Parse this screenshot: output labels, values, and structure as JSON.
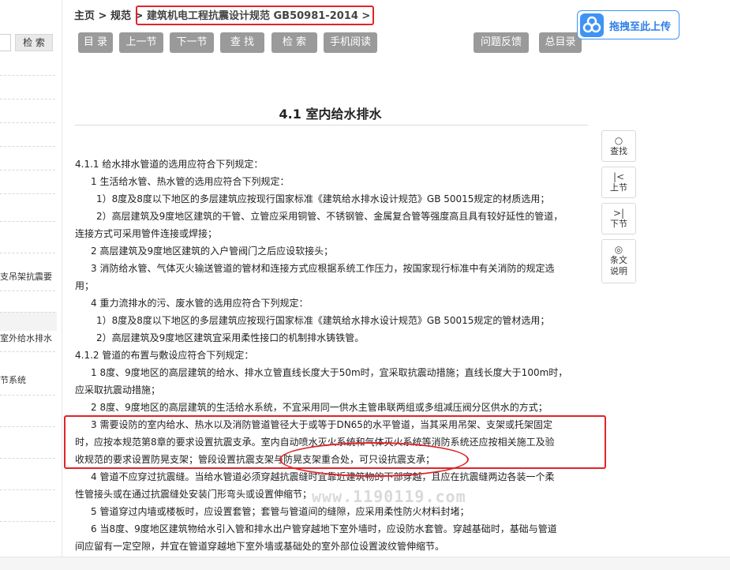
{
  "breadcrumb": {
    "home": "主页",
    "sep1": ">",
    "category": "规范",
    "sep2": ">",
    "current": "建筑机电工程抗震设计规范 GB50981-2014 >"
  },
  "toolbar": {
    "toc": "目 录",
    "prev": "上一节",
    "next": "下一节",
    "find": "查 找",
    "search": "检 索",
    "mobile": "手机阅读",
    "feedback": "问题反馈",
    "index": "总目录"
  },
  "sidebar": {
    "search_button": "检 索",
    "items": [
      "支吊架抗震要",
      "室外给水排水",
      "节系统"
    ]
  },
  "title": "4.1 室内给水排水",
  "paragraphs": [
    "4.1.1 给水排水管道的选用应符合下列规定：",
    "1 生活给水管、热水管的选用应符合下列规定：",
    "1）8度及8度以下地区的多层建筑应按现行国家标准《建筑给水排水设计规范》GB 50015规定的材质选用；",
    "2）高层建筑及9度地区建筑的干管、立管应采用铜管、不锈钢管、金属复合管等强度高且具有较好延性的管道，",
    "连接方式可采用管件连接或焊接；",
    "2 高层建筑及9度地区建筑的入户管阀门之后应设软接头；",
    "3 消防给水管、气体灭火输送管道的管材和连接方式应根据系统工作压力，按国家现行标准中有关消防的规定选",
    "用；",
    "4 重力流排水的污、废水管的选用应符合下列规定：",
    "1）8度及8度以下地区的多层建筑应按现行国家标准《建筑给水排水设计规范》GB 50015规定的管材选用；",
    "2）高层建筑及9度地区建筑宜采用柔性接口的机制排水铸铁管。",
    "4.1.2 管道的布置与敷设应符合下列规定：",
    "1 8度、9度地区的高层建筑的给水、排水立管直线长度大于50m时，宜采取抗震动措施；直线长度大于100m时，",
    "应采取抗震动措施；",
    "2 8度、9度地区的高层建筑的生活给水系统，不宜采用同一供水主管串联两组或多组减压阀分区供水的方式；",
    "3 需要设防的室内给水、热水以及消防管道管径大于或等于DN65的水平管道，当其采用吊架、支架或托架固定",
    "时，应按本规范第8章的要求设置抗震支承。室内自动喷水灭火系统和气体灭火系统等消防系统还应按相关施工及验",
    "收规范的要求设置防晃支架；管段设置抗震支架与防晃支架重合处，可只设抗震支承；",
    "4 管道不应穿过抗震缝。当给水管道必须穿越抗震缝时宜靠近建筑物的下部穿越，且应在抗震缝两边各装一个柔",
    "性管接头或在通过抗震缝处安装门形弯头或设置伸缩节；",
    "5 管道穿过内墙或楼板时，应设置套管；套管与管道间的缝隙，应采用柔性防火材料封堵；",
    "6 当8度、9度地区建筑物给水引入管和排水出户管穿越地下室外墙时，应设防水套管。穿越基础时，基础与管道",
    "间应留有一定空隙，并宜在管道穿越地下室外墙或基础处的室外部位设置波纹管伸缩节。"
  ],
  "watermark": "www.1190119.com",
  "rail": {
    "find": {
      "icon": "○",
      "label": "查找"
    },
    "prev": {
      "icon": "|<",
      "label": "上节"
    },
    "next": {
      "icon": ">|",
      "label": "下节"
    },
    "notes": {
      "icon": "◎",
      "label1": "条文",
      "label2": "说明"
    }
  },
  "upload": {
    "label": "拖拽至此上传"
  },
  "colors": {
    "accent": "#3e93f5",
    "annotation": "#e0242a",
    "button_gray": "#9a9a9a"
  }
}
